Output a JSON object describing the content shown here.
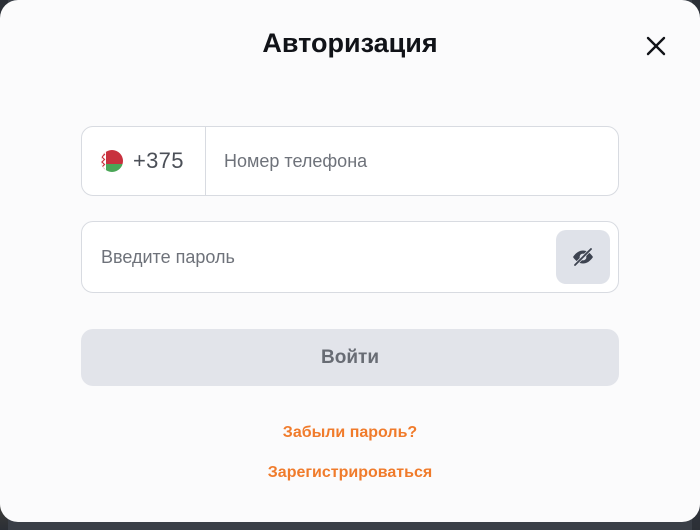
{
  "modal": {
    "title": "Авторизация",
    "close_icon": "close-icon"
  },
  "phone": {
    "country_flag": "belarus-flag-icon",
    "country_code": "+375",
    "placeholder": "Номер телефона",
    "value": ""
  },
  "password": {
    "placeholder": "Введите пароль",
    "value": "",
    "toggle_icon": "eye-slash-icon"
  },
  "actions": {
    "login_label": "Войти",
    "forgot_label": "Забыли пароль?",
    "register_label": "Зарегистрироваться"
  },
  "colors": {
    "accent": "#f07b2b",
    "flag_red": "#c8313e",
    "flag_green": "#4aa657"
  }
}
